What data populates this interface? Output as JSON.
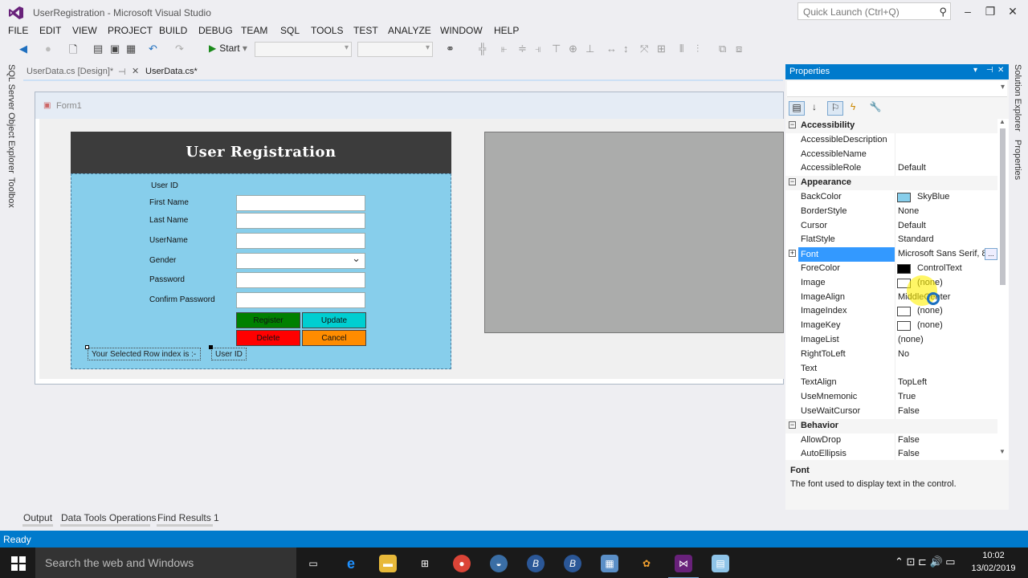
{
  "window": {
    "title": "UserRegistration - Microsoft Visual Studio",
    "quick_launch_placeholder": "Quick Launch (Ctrl+Q)"
  },
  "menu": [
    "FILE",
    "EDIT",
    "VIEW",
    "PROJECT",
    "BUILD",
    "DEBUG",
    "TEAM",
    "SQL",
    "TOOLS",
    "TEST",
    "ANALYZE",
    "WINDOW",
    "HELP"
  ],
  "toolbar": {
    "start_label": "Start"
  },
  "left_tabs": [
    "SQL Server Object Explorer",
    "Toolbox"
  ],
  "right_tabs": [
    "Solution Explorer",
    "Properties"
  ],
  "doc_tabs": {
    "design": "UserData.cs [Design]*",
    "code": "UserData.cs*"
  },
  "form": {
    "title": "Form1",
    "header": "User Registration",
    "labels": {
      "user_id": "User ID",
      "first_name": "First Name",
      "last_name": "Last Name",
      "username": "UserName",
      "gender": "Gender",
      "password": "Password",
      "confirm_password": "Confirm Password"
    },
    "buttons": {
      "register": "Register",
      "update": "Update",
      "delete": "Delete",
      "cancel": "Cancel"
    },
    "selected_row_label": "Your Selected Row index is :-",
    "user_id_label": "User ID"
  },
  "properties": {
    "title": "Properties",
    "rows": [
      {
        "type": "cat",
        "name": "Accessibility"
      },
      {
        "type": "prop",
        "name": "AccessibleDescription",
        "value": ""
      },
      {
        "type": "prop",
        "name": "AccessibleName",
        "value": ""
      },
      {
        "type": "prop",
        "name": "AccessibleRole",
        "value": "Default"
      },
      {
        "type": "cat",
        "name": "Appearance"
      },
      {
        "type": "prop",
        "name": "BackColor",
        "value": "SkyBlue",
        "swatch": "#87ceeb"
      },
      {
        "type": "prop",
        "name": "BorderStyle",
        "value": "None"
      },
      {
        "type": "prop",
        "name": "Cursor",
        "value": "Default"
      },
      {
        "type": "prop",
        "name": "FlatStyle",
        "value": "Standard"
      },
      {
        "type": "sel",
        "name": "Font",
        "value": "Microsoft Sans Serif, 8"
      },
      {
        "type": "prop",
        "name": "ForeColor",
        "value": "ControlText",
        "swatch": "#000000"
      },
      {
        "type": "prop",
        "name": "Image",
        "value": "(none)",
        "swatch": "#ffffff"
      },
      {
        "type": "prop",
        "name": "ImageAlign",
        "value": "MiddleCenter"
      },
      {
        "type": "prop",
        "name": "ImageIndex",
        "value": "(none)",
        "swatch": "#ffffff"
      },
      {
        "type": "prop",
        "name": "ImageKey",
        "value": "(none)",
        "swatch": "#ffffff"
      },
      {
        "type": "prop",
        "name": "ImageList",
        "value": "(none)"
      },
      {
        "type": "prop",
        "name": "RightToLeft",
        "value": "No"
      },
      {
        "type": "prop",
        "name": "Text",
        "value": ""
      },
      {
        "type": "prop",
        "name": "TextAlign",
        "value": "TopLeft"
      },
      {
        "type": "prop",
        "name": "UseMnemonic",
        "value": "True"
      },
      {
        "type": "prop",
        "name": "UseWaitCursor",
        "value": "False"
      },
      {
        "type": "cat",
        "name": "Behavior"
      },
      {
        "type": "prop",
        "name": "AllowDrop",
        "value": "False"
      },
      {
        "type": "prop",
        "name": "AutoEllipsis",
        "value": "False"
      }
    ],
    "description_title": "Font",
    "description_text": "The font used to display text in the control."
  },
  "bottom_tabs": [
    "Output",
    "Data Tools Operations",
    "Find Results 1"
  ],
  "status": "Ready",
  "taskbar": {
    "search_placeholder": "Search the web and Windows",
    "time": "10:02",
    "date": "13/02/2019"
  },
  "colors": {
    "accent": "#007acc",
    "header_bg": "#3c3c3c",
    "panel_bg": "#87ceeb",
    "register": "#008000",
    "update": "#00ced1",
    "delete": "#ff0000",
    "cancel": "#ff8c00",
    "grid_bg": "#abacab"
  }
}
